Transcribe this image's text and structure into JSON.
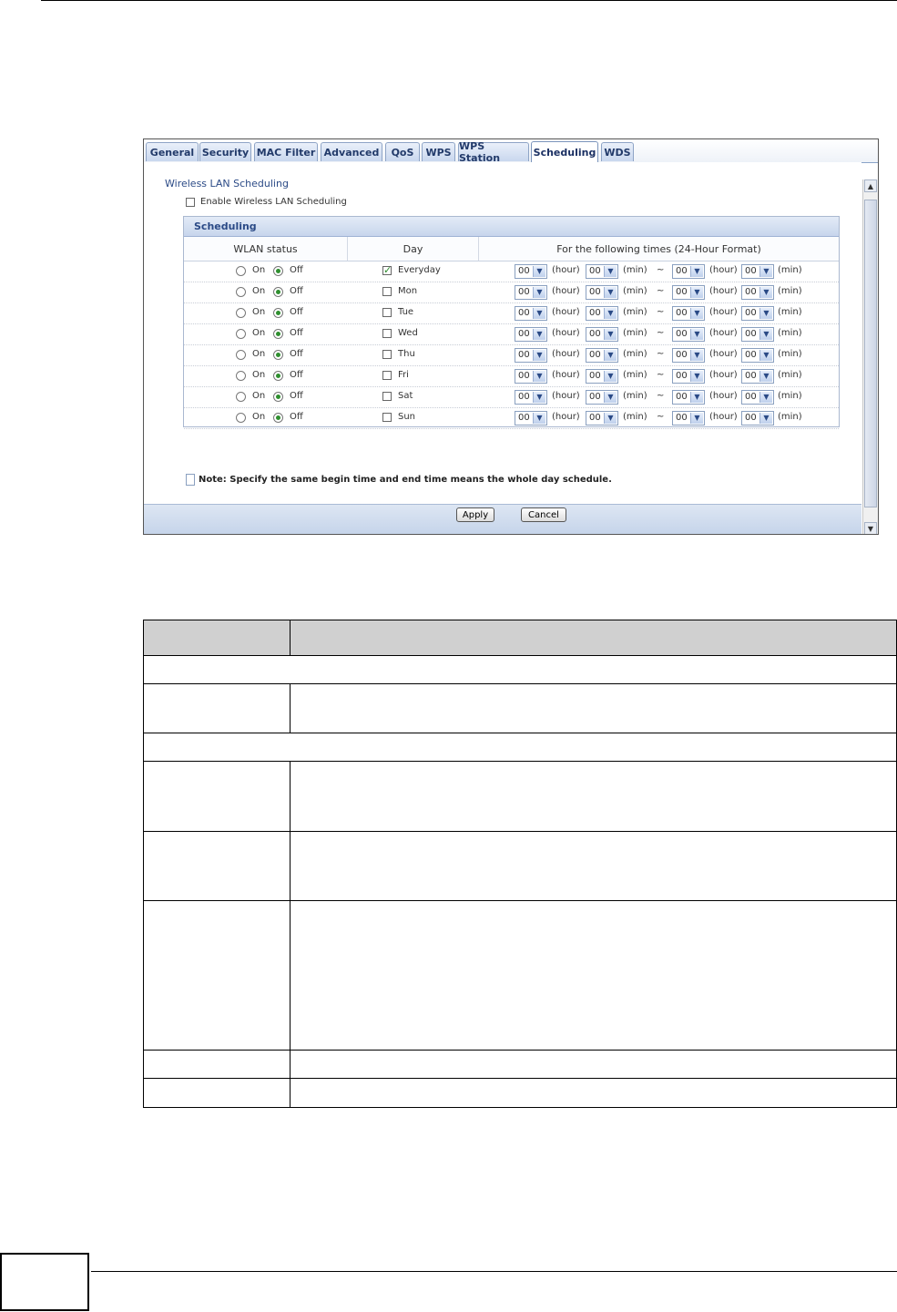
{
  "tabs": [
    "General",
    "Security",
    "MAC Filter",
    "Advanced",
    "QoS",
    "WPS",
    "WPS Station",
    "Scheduling",
    "WDS"
  ],
  "active_tab": "Scheduling",
  "section_title": "Wireless LAN Scheduling",
  "enable_label": "Enable Wireless LAN Scheduling",
  "enable_checked": false,
  "scheduling_box_title": "Scheduling",
  "columns": {
    "wlan_status": "WLAN status",
    "day": "Day",
    "times": "For the following times (24-Hour Format)"
  },
  "radio_labels": {
    "on": "On",
    "off": "Off"
  },
  "time_units": {
    "hour": "(hour)",
    "min": "(min)",
    "sep": "~"
  },
  "rows": [
    {
      "day": "Everyday",
      "checked": true,
      "status": "Off",
      "start_hour": "00",
      "start_min": "00",
      "end_hour": "00",
      "end_min": "00"
    },
    {
      "day": "Mon",
      "checked": false,
      "status": "Off",
      "start_hour": "00",
      "start_min": "00",
      "end_hour": "00",
      "end_min": "00"
    },
    {
      "day": "Tue",
      "checked": false,
      "status": "Off",
      "start_hour": "00",
      "start_min": "00",
      "end_hour": "00",
      "end_min": "00"
    },
    {
      "day": "Wed",
      "checked": false,
      "status": "Off",
      "start_hour": "00",
      "start_min": "00",
      "end_hour": "00",
      "end_min": "00"
    },
    {
      "day": "Thu",
      "checked": false,
      "status": "Off",
      "start_hour": "00",
      "start_min": "00",
      "end_hour": "00",
      "end_min": "00"
    },
    {
      "day": "Fri",
      "checked": false,
      "status": "Off",
      "start_hour": "00",
      "start_min": "00",
      "end_hour": "00",
      "end_min": "00"
    },
    {
      "day": "Sat",
      "checked": false,
      "status": "Off",
      "start_hour": "00",
      "start_min": "00",
      "end_hour": "00",
      "end_min": "00"
    },
    {
      "day": "Sun",
      "checked": false,
      "status": "Off",
      "start_hour": "00",
      "start_min": "00",
      "end_hour": "00",
      "end_min": "00"
    }
  ],
  "note": "Note: Specify the same begin time and end time means the whole day schedule.",
  "buttons": {
    "apply": "Apply",
    "cancel": "Cancel"
  },
  "colors": {
    "tab_text": "#223a6a",
    "header_blue": "#2b4a86",
    "button_bar": "#c5d4ea",
    "table_header": "#d0d0d0"
  }
}
